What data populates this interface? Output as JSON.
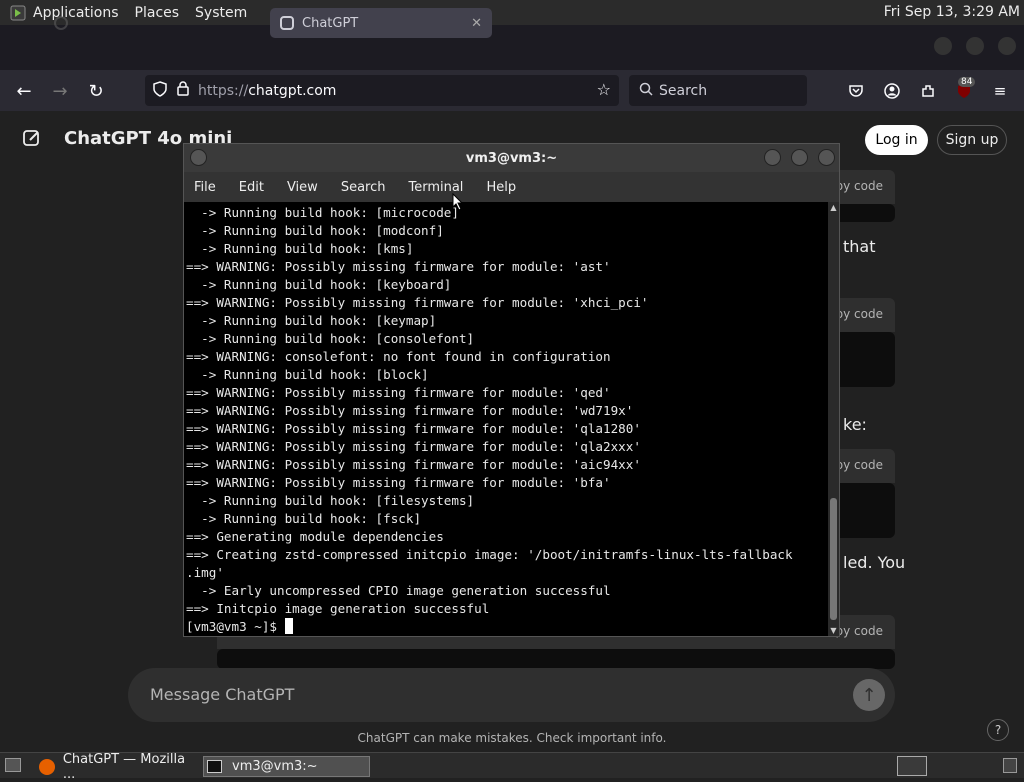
{
  "desktop": {
    "menus": [
      "Applications",
      "Places",
      "System"
    ],
    "clock": "Fri Sep 13,  3:29 AM"
  },
  "browser": {
    "tabs": [
      {
        "label": ""
      },
      {
        "label": "ChatGPT"
      }
    ],
    "url_proto": "https://",
    "url_host": "chatgpt.com",
    "search_placeholder": "Search",
    "badge": "84"
  },
  "chatgpt": {
    "title": "ChatGPT 4o mini",
    "login": "Log in",
    "signup": "Sign up",
    "copy_label": "py code",
    "fragments": [
      "that",
      "ke:",
      "led. You"
    ],
    "composer_placeholder": "Message ChatGPT",
    "disclaimer": "ChatGPT can make mistakes. Check important info.",
    "help": "?"
  },
  "terminal": {
    "title": "vm3@vm3:~",
    "menu": [
      "File",
      "Edit",
      "View",
      "Search",
      "Terminal",
      "Help"
    ],
    "lines": [
      "  -> Running build hook: [microcode]",
      "  -> Running build hook: [modconf]",
      "  -> Running build hook: [kms]",
      "==> WARNING: Possibly missing firmware for module: 'ast'",
      "  -> Running build hook: [keyboard]",
      "==> WARNING: Possibly missing firmware for module: 'xhci_pci'",
      "  -> Running build hook: [keymap]",
      "  -> Running build hook: [consolefont]",
      "==> WARNING: consolefont: no font found in configuration",
      "  -> Running build hook: [block]",
      "==> WARNING: Possibly missing firmware for module: 'qed'",
      "==> WARNING: Possibly missing firmware for module: 'wd719x'",
      "==> WARNING: Possibly missing firmware for module: 'qla1280'",
      "==> WARNING: Possibly missing firmware for module: 'qla2xxx'",
      "==> WARNING: Possibly missing firmware for module: 'aic94xx'",
      "==> WARNING: Possibly missing firmware for module: 'bfa'",
      "  -> Running build hook: [filesystems]",
      "  -> Running build hook: [fsck]",
      "==> Generating module dependencies",
      "==> Creating zstd-compressed initcpio image: '/boot/initramfs-linux-lts-fallback",
      ".img'",
      "  -> Early uncompressed CPIO image generation successful",
      "==> Initcpio image generation successful"
    ],
    "prompt": "[vm3@vm3 ~]$ "
  },
  "taskbar": {
    "items": [
      "ChatGPT — Mozilla ...",
      "vm3@vm3:~"
    ]
  }
}
